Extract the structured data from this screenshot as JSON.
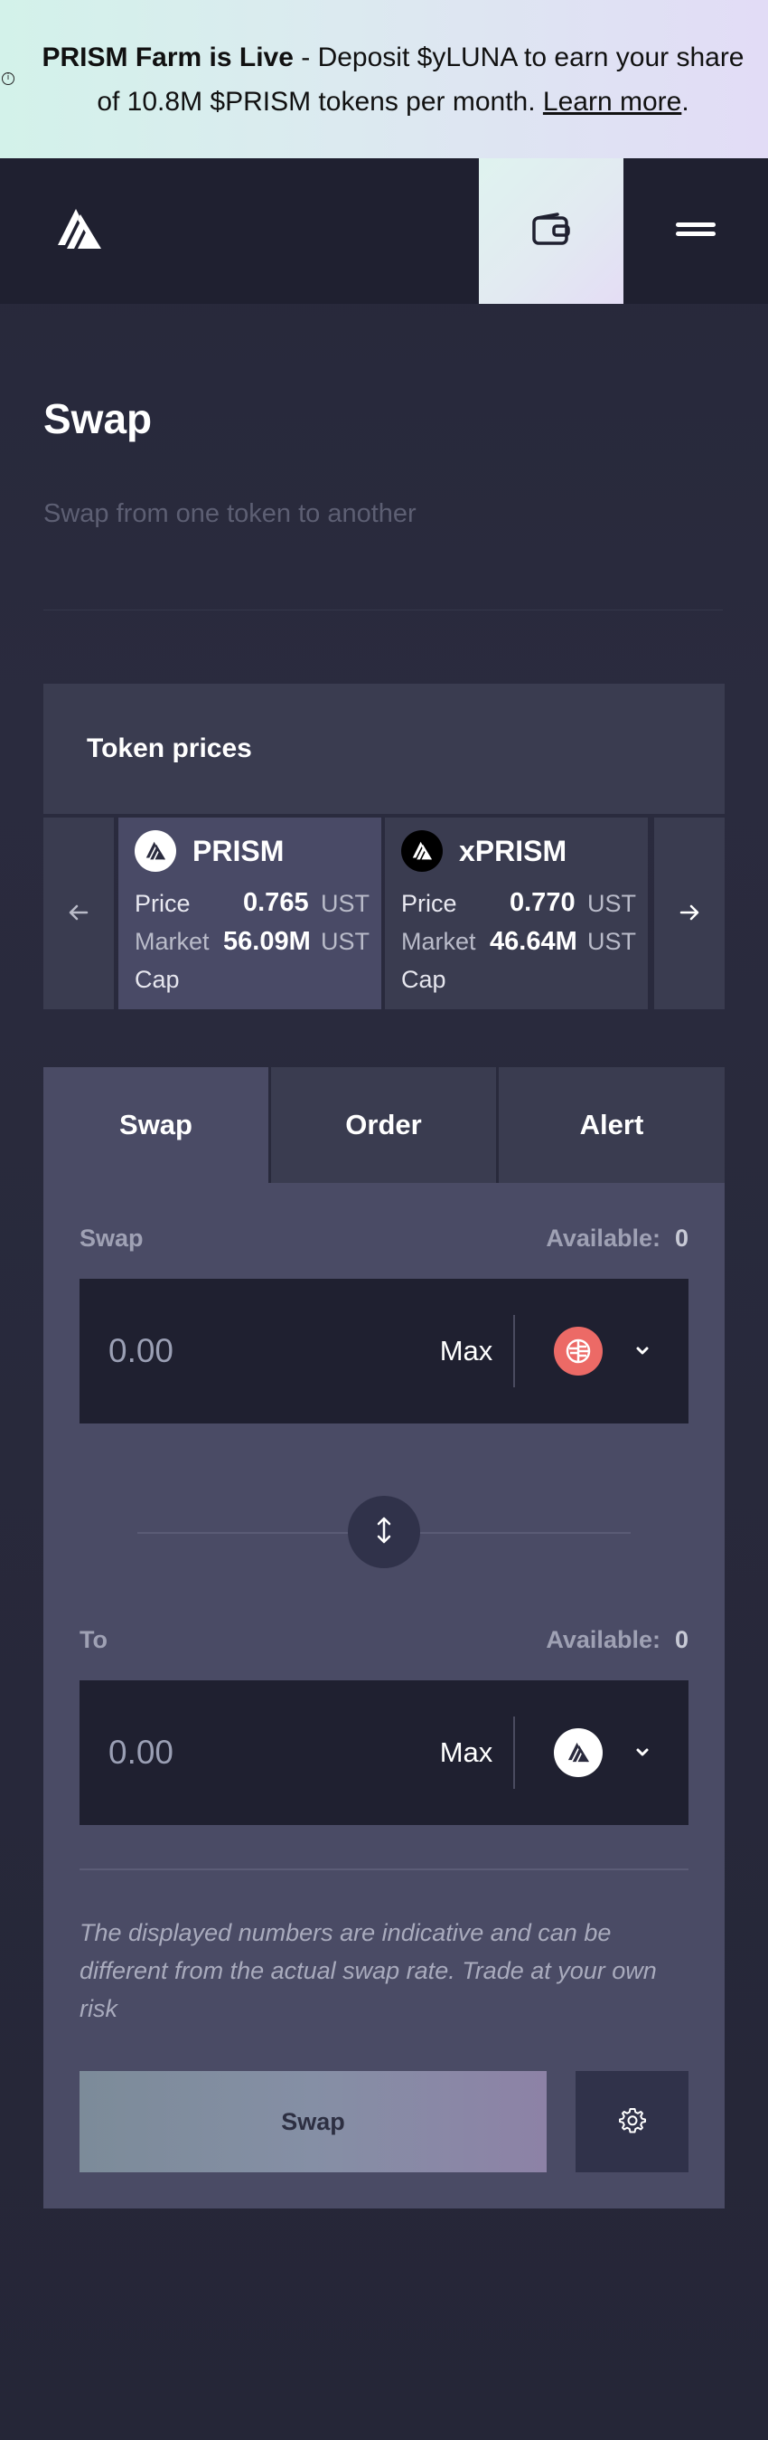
{
  "banner": {
    "title": "PRISM Farm is Live",
    "text_prefix": " - Deposit $yLUNA to earn your share of 10.8M $PRISM tokens per month. ",
    "link": "Learn more",
    "suffix": ".",
    "icon": "info-icon"
  },
  "header": {
    "logo": "prism-logo",
    "wallet_icon": "wallet-icon",
    "menu_icon": "menu-icon"
  },
  "page": {
    "title": "Swap",
    "subtitle": "Swap from one token to another"
  },
  "token_prices": {
    "heading": "Token prices",
    "price_label": "Price",
    "market_cap_label_1": "Market",
    "market_cap_label_2": "Cap",
    "tokens": [
      {
        "name": "PRISM",
        "price": "0.765",
        "price_unit": "UST",
        "market_cap": "56.09M",
        "market_cap_unit": "UST"
      },
      {
        "name": "xPRISM",
        "price": "0.770",
        "price_unit": "UST",
        "market_cap": "46.64M",
        "market_cap_unit": "UST"
      }
    ]
  },
  "tabs": [
    "Swap",
    "Order",
    "Alert"
  ],
  "swap_form": {
    "from_label": "Swap",
    "to_label": "To",
    "available_label": "Available:",
    "from_available": "0",
    "to_available": "0",
    "from_placeholder": "0.00",
    "to_placeholder": "0.00",
    "max_label": "Max",
    "disclaimer": "The displayed numbers are indicative and can be different from the actual swap rate. Trade at your own risk",
    "submit_label": "Swap"
  },
  "colors": {
    "background": "#262739",
    "panel": "#4a4b65",
    "card": "#3a3c50",
    "input_box": "#1f2030",
    "from_token_icon": "#ec6a66"
  }
}
